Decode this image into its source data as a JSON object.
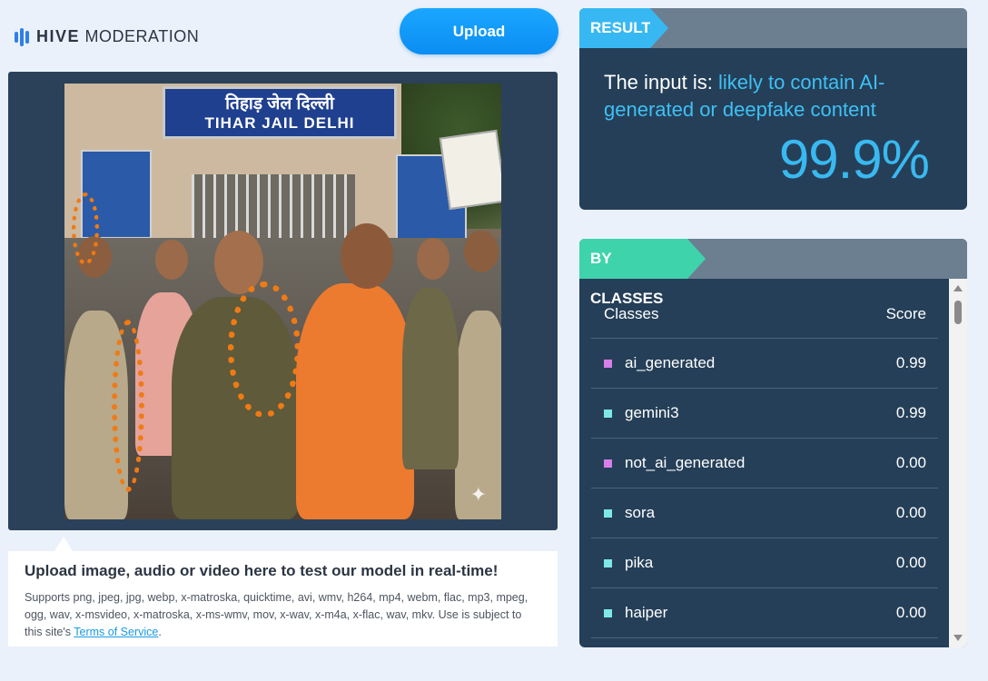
{
  "header": {
    "logo_bold": "HIVE",
    "logo_light": "MODERATION",
    "upload_label": "Upload"
  },
  "preview": {
    "sign_hindi": "तिहाड़ जेल दिल्ली",
    "sign_english": "TIHAR JAIL DELHI"
  },
  "info": {
    "title": "Upload image, audio or video here to test our model in real-time!",
    "description_prefix": "Supports png, jpeg, jpg, webp, x-matroska, quicktime, avi, wmv, h264, mp4, webm, flac, mp3, mpeg, ogg, wav, x-msvideo, x-matroska, x-ms-wmv, mov, x-wav, x-m4a, x-flac, wav, mkv. Use is subject to this site's ",
    "terms_link": "Terms of Service",
    "description_suffix": "."
  },
  "result": {
    "tag": "RESULT",
    "text_prefix": "The input is: ",
    "text_highlight": "likely to contain AI-generated or deepfake content",
    "percentage": "99.9%"
  },
  "classes": {
    "tag": "BY CLASSES",
    "col_classes": "Classes",
    "col_score": "Score",
    "rows": [
      {
        "name": "ai_generated",
        "score": "0.99",
        "color": "#d77ee8"
      },
      {
        "name": "gemini3",
        "score": "0.99",
        "color": "#7fe8e6"
      },
      {
        "name": "not_ai_generated",
        "score": "0.00",
        "color": "#d77ee8"
      },
      {
        "name": "sora",
        "score": "0.00",
        "color": "#7fe8e6"
      },
      {
        "name": "pika",
        "score": "0.00",
        "color": "#7fe8e6"
      },
      {
        "name": "haiper",
        "score": "0.00",
        "color": "#7fe8e6"
      }
    ]
  },
  "colors": {
    "accent_blue": "#38b8f2",
    "accent_green": "#3fd3ac",
    "panel_bg": "#253f58"
  }
}
